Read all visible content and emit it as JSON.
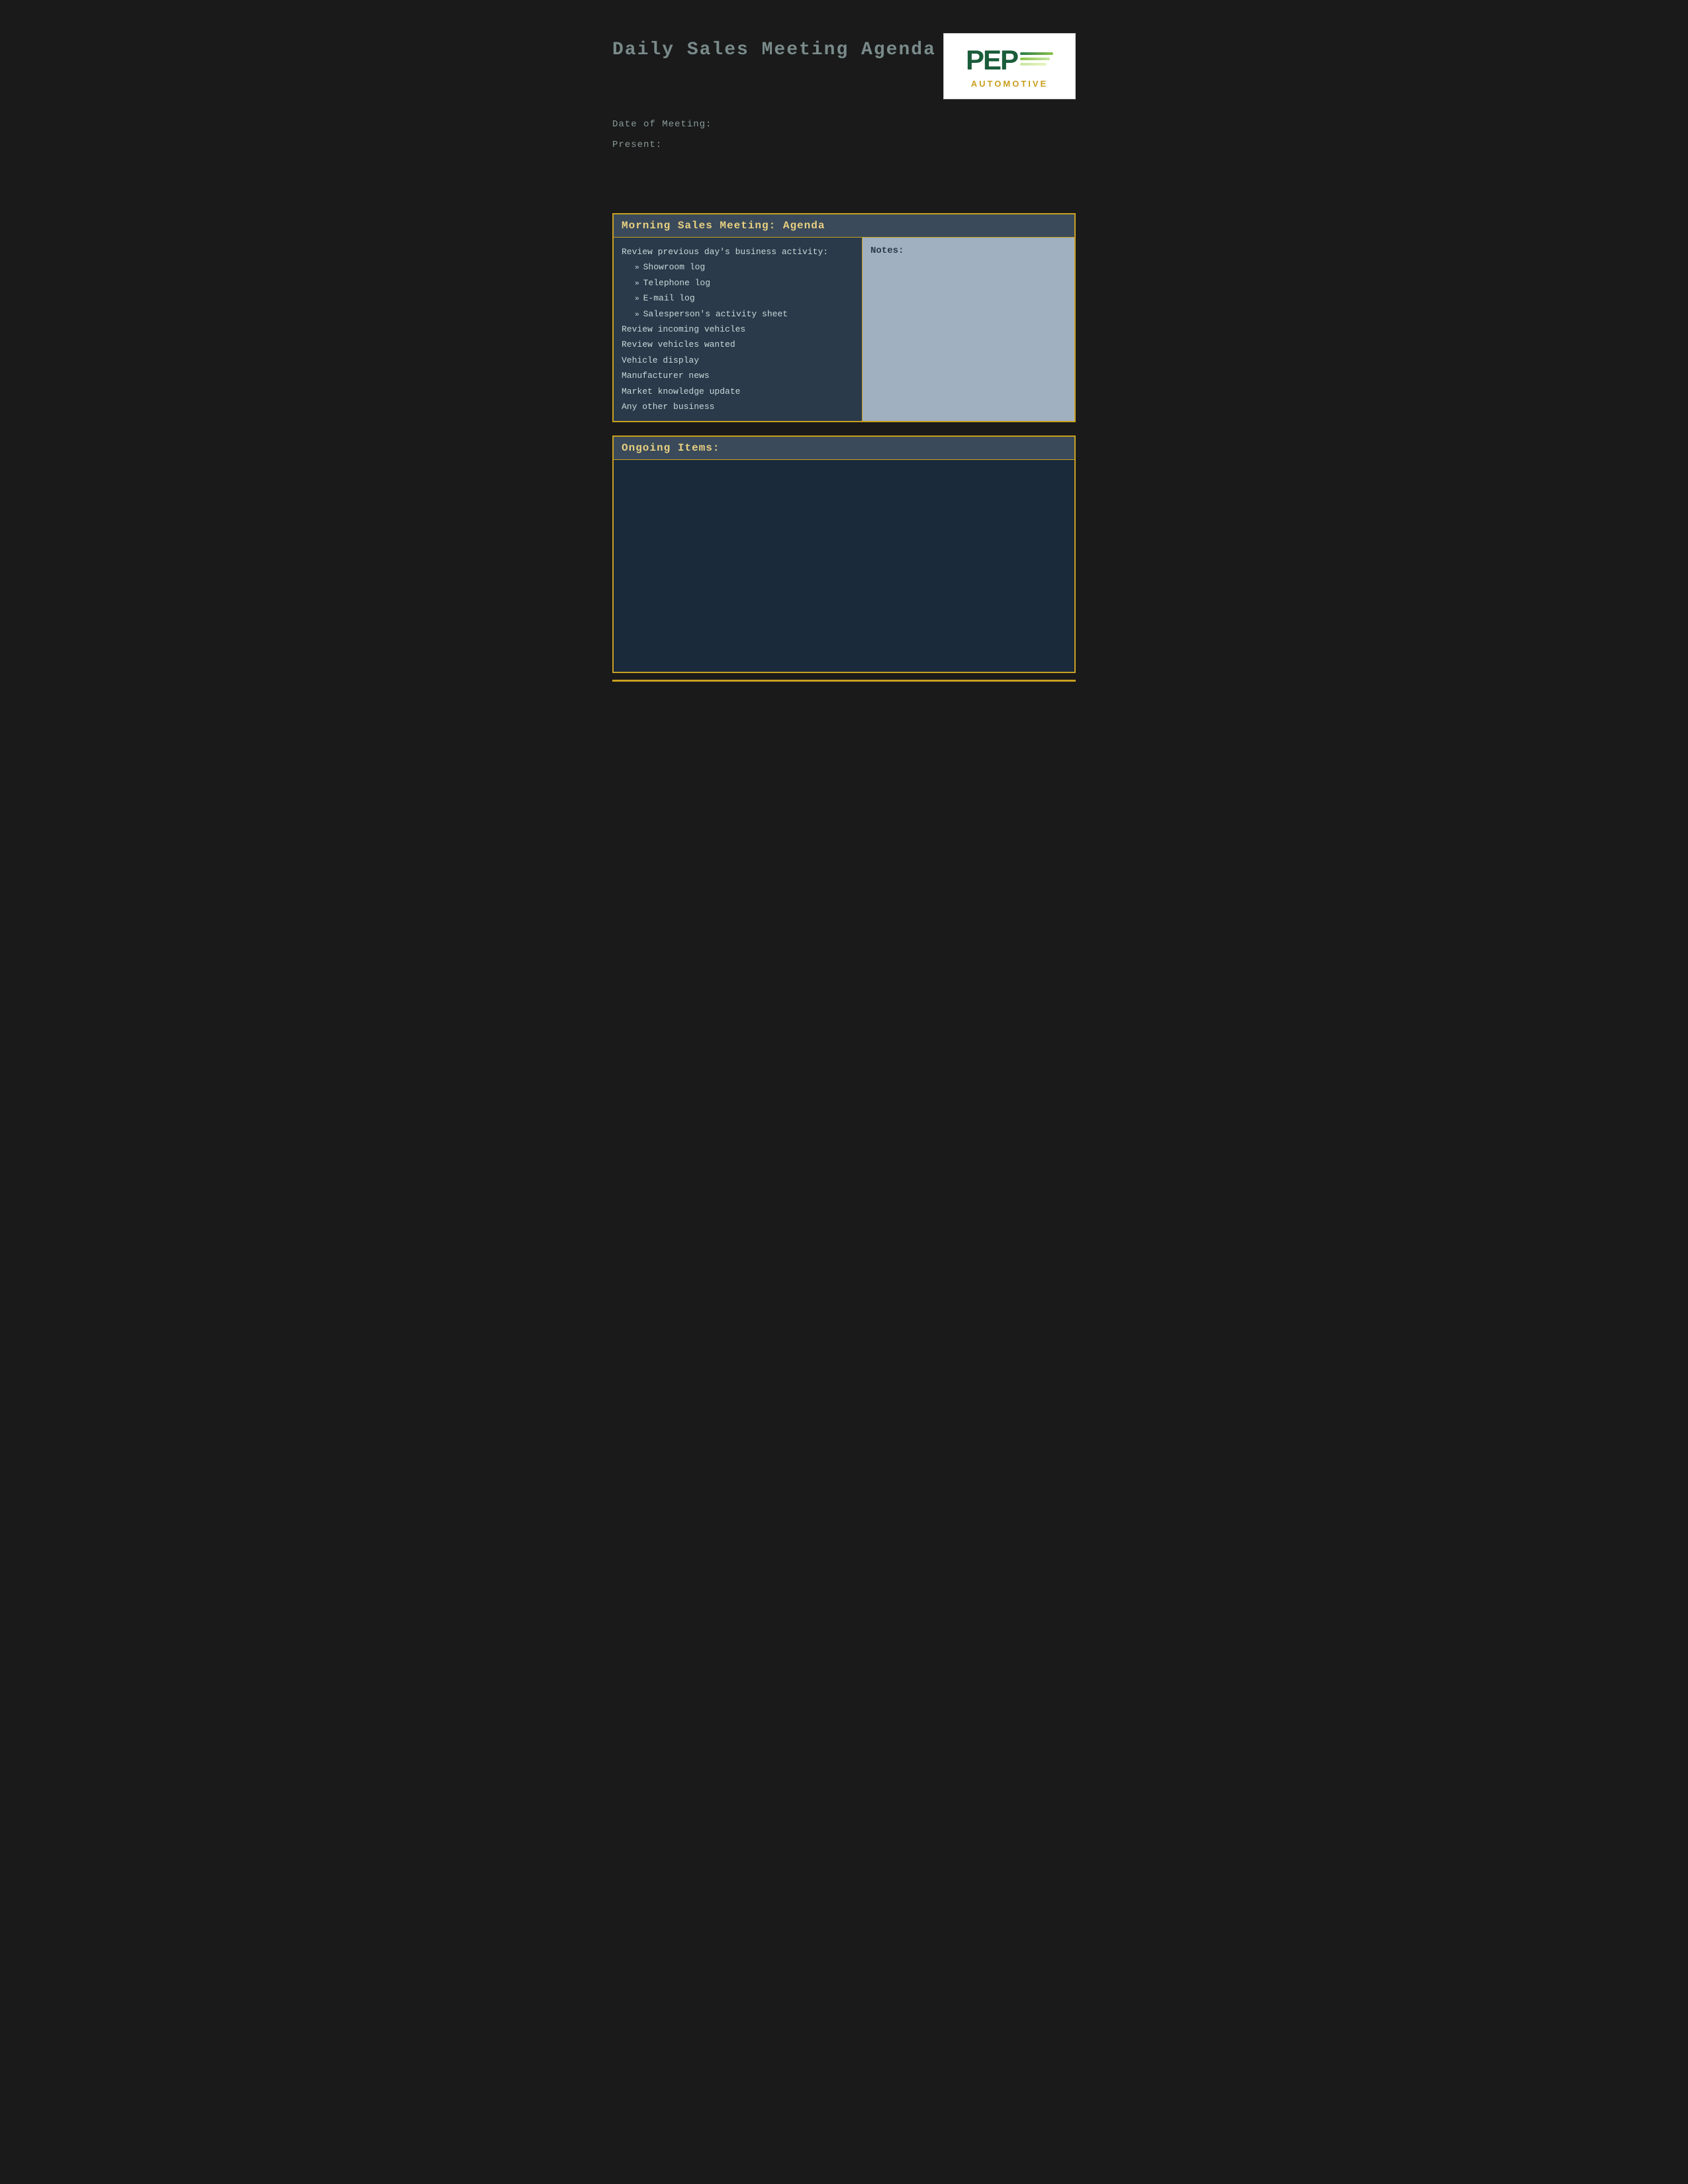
{
  "page": {
    "title": "Daily Sales Meeting Agenda",
    "background": "#1a1a1a"
  },
  "header": {
    "title": "Daily Sales Meeting Agenda",
    "logo": {
      "pep_text": "PEP",
      "automotive_text": "AUTOMOTIVE"
    }
  },
  "meta": {
    "date_label": "Date of Meeting:",
    "present_label": "Present:"
  },
  "morning_section": {
    "header": "Morning Sales Meeting: Agenda",
    "agenda": {
      "main_label": "Review previous day's business activity:",
      "sub_items": [
        "Showroom log",
        "Telephone log",
        "E-mail log",
        "Salesperson's activity sheet"
      ],
      "other_items": [
        "Review incoming vehicles",
        "Review vehicles wanted",
        "Vehicle display",
        "Manufacturer news",
        "Market knowledge update",
        "Any other business"
      ]
    },
    "notes_label": "Notes:"
  },
  "ongoing_section": {
    "header": "Ongoing Items:"
  }
}
